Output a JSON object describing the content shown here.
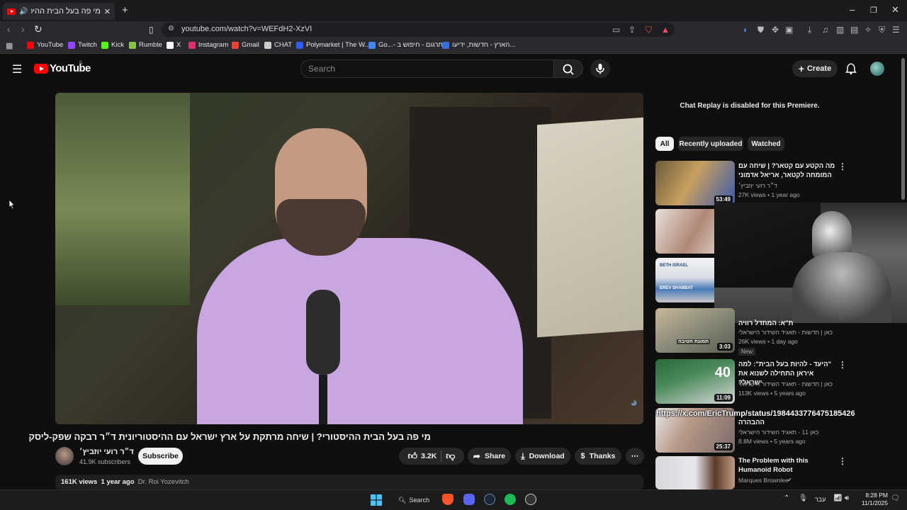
{
  "browser": {
    "tab_title": "מי פה בעל הבית ההיסטורי?| ...",
    "url": "youtube.com/watch?v=WEFdH2-XzVI",
    "bookmarks": [
      {
        "label": "YouTube",
        "color": "#ff0000"
      },
      {
        "label": "Twitch",
        "color": "#9146ff"
      },
      {
        "label": "Kick",
        "color": "#53fc18"
      },
      {
        "label": "Rumble",
        "color": "#85c742"
      },
      {
        "label": "X",
        "color": "#ffffff"
      },
      {
        "label": "Instagram",
        "color": "#e1306c"
      },
      {
        "label": "Gmail",
        "color": "#ea4335"
      },
      {
        "label": "CHAT",
        "color": "#cccccc"
      },
      {
        "label": "Polymarket | The W...",
        "color": "#2f5cff"
      },
      {
        "label": "Go...- תרגום - חיפוש ב",
        "color": "#4285f4"
      },
      {
        "label": "הארץ - חדשות, ידיעו...",
        "color": "#3a6fd8"
      }
    ]
  },
  "youtube": {
    "logo": "YouTube",
    "logo_region": "IL",
    "search_placeholder": "Search",
    "create_label": "Create"
  },
  "video": {
    "title": "מי פה בעל הבית ההיסטורי? | שיחה מרתקת על ארץ ישראל עם ההיסטוריונית ד״ר רבקה שפק-ליסק",
    "channel": "ד״ר רועי יוזביץ׳",
    "subscribers": "41.9K subscribers",
    "subscribe_label": "Subscribe",
    "likes": "3.2K",
    "share_label": "Share",
    "download_label": "Download",
    "thanks_label": "Thanks",
    "views": "161K views",
    "age": "1 year ago",
    "desc_author": "Dr. Roi Yozevitch"
  },
  "sidebar": {
    "chat_replay": "Chat Replay is disabled for this Premiere.",
    "chips": [
      "All",
      "Recently uploaded",
      "Watched"
    ],
    "videos": [
      {
        "title": "מה הקטע עם קטאר? | שיחה עם המומחה לקטאר, אריאל אדמוני",
        "channel": "ד״ר רועי יוזביץ׳",
        "meta": "27K views • 1 year ago",
        "duration": "53:49"
      },
      {
        "title": "",
        "channel": "",
        "meta": "",
        "duration": ""
      },
      {
        "title": "",
        "channel": "",
        "meta": "",
        "duration": ""
      },
      {
        "title": "ת\"א: המחדל רוויה",
        "channel": "כאן | חדשות - תאגיד השידור הישראלי",
        "meta": "26K views • 1 day ago",
        "duration": "3:03",
        "badge": "New"
      },
      {
        "title": "\"היעד - להיות בעל הבית\": למה איראן התחילה לשנוא את ישראל?",
        "channel": "כאן | חדשות - תאגיד השידור הישראלי",
        "meta": "113K views • 5 years ago",
        "duration": "11:09"
      },
      {
        "title": "ההבהרה",
        "channel": "כאן 11 - תאגיד השידור הישראלי",
        "meta": "8.8M views • 5 years ago",
        "duration": "25:37"
      },
      {
        "title": "The Problem with this Humanoid Robot",
        "channel": "Marques Brownlee",
        "meta": "",
        "duration": ""
      }
    ],
    "overlay_link": "https://x.com/EricTrump/status/1984433776475185426"
  },
  "taskbar": {
    "search_label": "Search",
    "lang": "עבר",
    "time": "8:28 PM",
    "date": "11/1/2025"
  },
  "colors": {
    "bg": "#0f0f0f",
    "chrome": "#2a2a2e",
    "yt_red": "#ff0000"
  }
}
